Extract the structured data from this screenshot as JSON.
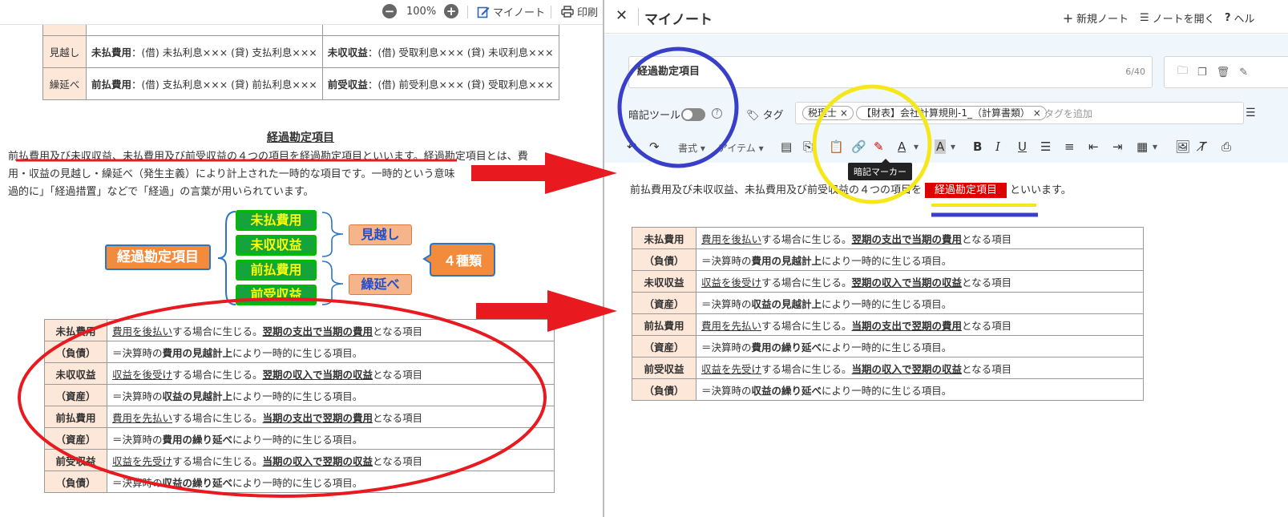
{
  "viewer": {
    "zoom": "100%",
    "mynote_label": "マイノート",
    "print_label": "印刷"
  },
  "top_table": {
    "rows": [
      {
        "head": "見越し",
        "c1_bold": "未払費用",
        "c1_text": "：(借) 未払利息××× (貸) 支払利息×××",
        "c2_bold": "未収収益",
        "c2_text": "：(借) 受取利息××× (貸) 未収利息×××"
      },
      {
        "head": "繰延べ",
        "c1_bold": "前払費用",
        "c1_text": "：(借) 支払利息××× (貸) 前払利息×××",
        "c2_bold": "前受収益",
        "c2_text": "：(借) 前受利息××× (貸) 受取利息×××"
      }
    ]
  },
  "section": {
    "title": "経過勘定項目",
    "para_line1": "前払費用及び未収収益、未払費用及び前受収益の４つの項目を経過勘定項目といいます。経過勘定項目とは、費",
    "para_line2": "用・収益の見越し・繰延べ（発生主義）により計上された一時的な項目です。一時的という意味",
    "para_line3": "過的に」「経過措置」などで「経過」の言葉が用いられています。"
  },
  "diagram": {
    "root": "経過勘定項目",
    "items": [
      "未払費用",
      "未収収益",
      "前払費用",
      "前受収益"
    ],
    "group1": "見越し",
    "group2": "繰延べ",
    "count": "４種類"
  },
  "bottom_table": {
    "rows": [
      {
        "name": "未払費用",
        "kind": "（負債）",
        "l1_pre": "費用を後払い",
        "l1_mid": "する場合に生じる。",
        "l1_bold": "翌期の支出で当期の費用",
        "l1_post": "となる項目",
        "l2_pre": "＝決算時の",
        "l2_bold": "費用の見越計上",
        "l2_post": "により一時的に生じる項目。"
      },
      {
        "name": "未収収益",
        "kind": "（資産）",
        "l1_pre": "収益を後受け",
        "l1_mid": "する場合に生じる。",
        "l1_bold": "翌期の収入で当期の収益",
        "l1_post": "となる項目",
        "l2_pre": "＝決算時の",
        "l2_bold": "収益の見越計上",
        "l2_post": "により一時的に生じる項目。"
      },
      {
        "name": "前払費用",
        "kind": "（資産）",
        "l1_pre": "費用を先払い",
        "l1_mid": "する場合に生じる。",
        "l1_bold": "当期の支出で翌期の費用",
        "l1_post": "となる項目",
        "l2_pre": "＝決算時の",
        "l2_bold": "費用の繰り延べ",
        "l2_post": "により一時的に生じる項目。"
      },
      {
        "name": "前受収益",
        "kind": "（負債）",
        "l1_pre": "収益を先受け",
        "l1_mid": "する場合に生じる。",
        "l1_bold": "当期の収入で翌期の収益",
        "l1_post": "となる項目",
        "l2_pre": "＝決算時の",
        "l2_bold": "収益の繰り延べ",
        "l2_post": "により一時的に生じる項目。"
      }
    ]
  },
  "note_panel": {
    "title": "マイノート",
    "new_note": "新規ノート",
    "open_note": "ノートを開く",
    "help": "ヘル",
    "note_title": "経過勘定項目",
    "char_count": "6/40",
    "memo_tool": "暗記ツール",
    "tag_label": "タグ",
    "tags": [
      "税理士",
      "【財表】会社計算規則-1_（計算書類）"
    ],
    "tag_placeholder": "タグを追加",
    "format_menu": "書式",
    "item_menu": "アイテム",
    "tooltip": "暗記マーカー",
    "editor_pre": "前払費用及び未収収益、未払費用及び前受収益の４つの項目を",
    "editor_marked": "経過勘定項目",
    "editor_post": "といいます。"
  },
  "colors": {
    "red_annotation": "#e8191f",
    "blue_annotation": "#3a3fc9",
    "yellow_annotation": "#f5e71a",
    "marker_red": "#dd0000"
  }
}
